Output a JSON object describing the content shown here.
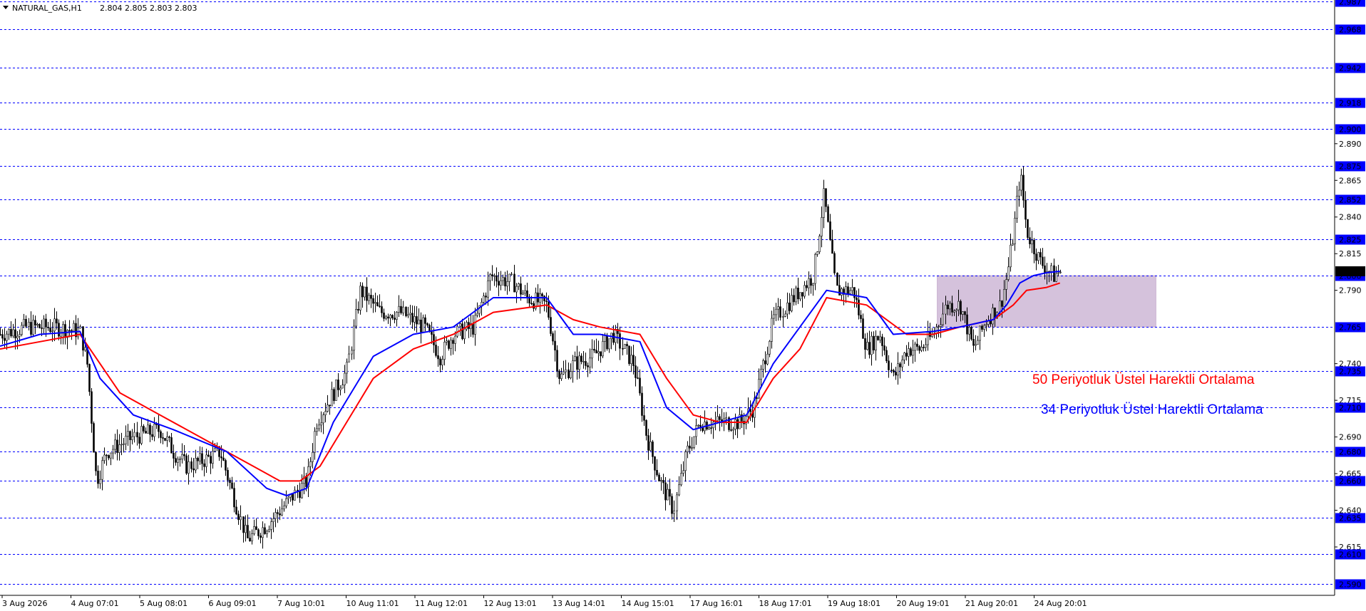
{
  "header": {
    "symbol": "NATURAL_GAS,H1",
    "ohlc": "2.804 2.805 2.803 2.803"
  },
  "chart_data": {
    "type": "candlestick",
    "symbol": "NATURAL_GAS,H1",
    "ylim": [
      2.582,
      2.988
    ],
    "y_ticks": [
      "2.890",
      "2.865",
      "2.840",
      "2.815",
      "2.790",
      "2.740",
      "2.715",
      "2.690",
      "2.665",
      "2.640",
      "2.615"
    ],
    "levels": [
      "2.987",
      "2.968",
      "2.942",
      "2.918",
      "2.900",
      "2.875",
      "2.852",
      "2.825",
      "2.800",
      "2.765",
      "2.735",
      "2.710",
      "2.680",
      "2.660",
      "2.635",
      "2.610",
      "2.590"
    ],
    "current_price": "2.803",
    "x_labels": [
      "3 Aug 2026",
      "4 Aug 07:01",
      "5 Aug 08:01",
      "6 Aug 09:01",
      "7 Aug 10:01",
      "10 Aug 11:01",
      "11 Aug 12:01",
      "12 Aug 13:01",
      "13 Aug 14:01",
      "14 Aug 15:01",
      "17 Aug 16:01",
      "18 Aug 17:01",
      "19 Aug 18:01",
      "20 Aug 19:01",
      "21 Aug 20:01",
      "24 Aug 20:01"
    ],
    "zone": {
      "x_from": 0.703,
      "x_to": 0.867,
      "y_low": 2.765,
      "y_high": 2.8,
      "color": "#d5c2dc"
    },
    "close_path": [
      [
        0,
        2.76
      ],
      [
        0.02,
        2.765
      ],
      [
        0.04,
        2.765
      ],
      [
        0.06,
        2.762
      ],
      [
        0.065,
        2.74
      ],
      [
        0.072,
        2.66
      ],
      [
        0.08,
        2.68
      ],
      [
        0.1,
        2.69
      ],
      [
        0.12,
        2.695
      ],
      [
        0.13,
        2.68
      ],
      [
        0.14,
        2.67
      ],
      [
        0.155,
        2.675
      ],
      [
        0.165,
        2.68
      ],
      [
        0.175,
        2.65
      ],
      [
        0.185,
        2.62
      ],
      [
        0.2,
        2.63
      ],
      [
        0.215,
        2.645
      ],
      [
        0.23,
        2.66
      ],
      [
        0.237,
        2.7
      ],
      [
        0.25,
        2.72
      ],
      [
        0.26,
        2.735
      ],
      [
        0.27,
        2.79
      ],
      [
        0.285,
        2.775
      ],
      [
        0.3,
        2.775
      ],
      [
        0.318,
        2.765
      ],
      [
        0.33,
        2.745
      ],
      [
        0.34,
        2.76
      ],
      [
        0.355,
        2.765
      ],
      [
        0.368,
        2.8
      ],
      [
        0.385,
        2.795
      ],
      [
        0.395,
        2.785
      ],
      [
        0.41,
        2.78
      ],
      [
        0.42,
        2.73
      ],
      [
        0.43,
        2.74
      ],
      [
        0.445,
        2.745
      ],
      [
        0.46,
        2.76
      ],
      [
        0.475,
        2.74
      ],
      [
        0.485,
        2.69
      ],
      [
        0.495,
        2.66
      ],
      [
        0.505,
        2.64
      ],
      [
        0.515,
        2.68
      ],
      [
        0.525,
        2.7
      ],
      [
        0.54,
        2.7
      ],
      [
        0.555,
        2.7
      ],
      [
        0.565,
        2.71
      ],
      [
        0.58,
        2.77
      ],
      [
        0.595,
        2.785
      ],
      [
        0.61,
        2.8
      ],
      [
        0.618,
        2.855
      ],
      [
        0.627,
        2.79
      ],
      [
        0.64,
        2.79
      ],
      [
        0.65,
        2.75
      ],
      [
        0.66,
        2.76
      ],
      [
        0.67,
        2.73
      ],
      [
        0.68,
        2.75
      ],
      [
        0.69,
        2.75
      ],
      [
        0.7,
        2.76
      ],
      [
        0.71,
        2.78
      ],
      [
        0.72,
        2.78
      ],
      [
        0.73,
        2.75
      ],
      [
        0.74,
        2.77
      ],
      [
        0.75,
        2.78
      ],
      [
        0.755,
        2.8
      ],
      [
        0.76,
        2.83
      ],
      [
        0.765,
        2.87
      ],
      [
        0.77,
        2.83
      ],
      [
        0.78,
        2.81
      ],
      [
        0.79,
        2.8
      ],
      [
        0.795,
        2.803
      ]
    ],
    "series": [
      {
        "name": "50 Periyotluk Üstel Harektli Ortalama",
        "color": "#ff0000",
        "points": [
          [
            0,
            2.75
          ],
          [
            0.03,
            2.755
          ],
          [
            0.06,
            2.76
          ],
          [
            0.075,
            2.74
          ],
          [
            0.09,
            2.72
          ],
          [
            0.12,
            2.705
          ],
          [
            0.16,
            2.685
          ],
          [
            0.19,
            2.67
          ],
          [
            0.21,
            2.66
          ],
          [
            0.225,
            2.66
          ],
          [
            0.24,
            2.67
          ],
          [
            0.26,
            2.7
          ],
          [
            0.28,
            2.73
          ],
          [
            0.31,
            2.75
          ],
          [
            0.34,
            2.76
          ],
          [
            0.37,
            2.775
          ],
          [
            0.41,
            2.78
          ],
          [
            0.43,
            2.77
          ],
          [
            0.45,
            2.765
          ],
          [
            0.48,
            2.76
          ],
          [
            0.5,
            2.73
          ],
          [
            0.52,
            2.705
          ],
          [
            0.54,
            2.7
          ],
          [
            0.56,
            2.7
          ],
          [
            0.58,
            2.73
          ],
          [
            0.6,
            2.75
          ],
          [
            0.62,
            2.785
          ],
          [
            0.65,
            2.78
          ],
          [
            0.68,
            2.76
          ],
          [
            0.7,
            2.76
          ],
          [
            0.72,
            2.765
          ],
          [
            0.745,
            2.77
          ],
          [
            0.76,
            2.78
          ],
          [
            0.77,
            2.79
          ],
          [
            0.785,
            2.792
          ],
          [
            0.795,
            2.795
          ]
        ]
      },
      {
        "name": "34  Periyotluk Üstel Harektli Ortalama",
        "color": "#0000ff",
        "points": [
          [
            0,
            2.752
          ],
          [
            0.03,
            2.76
          ],
          [
            0.06,
            2.762
          ],
          [
            0.075,
            2.73
          ],
          [
            0.1,
            2.705
          ],
          [
            0.13,
            2.695
          ],
          [
            0.17,
            2.68
          ],
          [
            0.2,
            2.655
          ],
          [
            0.215,
            2.65
          ],
          [
            0.23,
            2.655
          ],
          [
            0.25,
            2.7
          ],
          [
            0.28,
            2.745
          ],
          [
            0.31,
            2.76
          ],
          [
            0.34,
            2.765
          ],
          [
            0.37,
            2.785
          ],
          [
            0.41,
            2.785
          ],
          [
            0.43,
            2.76
          ],
          [
            0.45,
            2.76
          ],
          [
            0.48,
            2.755
          ],
          [
            0.5,
            2.71
          ],
          [
            0.52,
            2.695
          ],
          [
            0.54,
            2.7
          ],
          [
            0.56,
            2.705
          ],
          [
            0.58,
            2.74
          ],
          [
            0.6,
            2.765
          ],
          [
            0.62,
            2.79
          ],
          [
            0.65,
            2.785
          ],
          [
            0.67,
            2.76
          ],
          [
            0.7,
            2.762
          ],
          [
            0.72,
            2.765
          ],
          [
            0.745,
            2.77
          ],
          [
            0.755,
            2.78
          ],
          [
            0.765,
            2.795
          ],
          [
            0.775,
            2.8
          ],
          [
            0.785,
            2.802
          ],
          [
            0.795,
            2.803
          ]
        ]
      }
    ]
  },
  "colors": {
    "grid": "#0000ff",
    "candle": "#000000",
    "price_tag": "#0000ff",
    "current_tag": "#000000"
  }
}
